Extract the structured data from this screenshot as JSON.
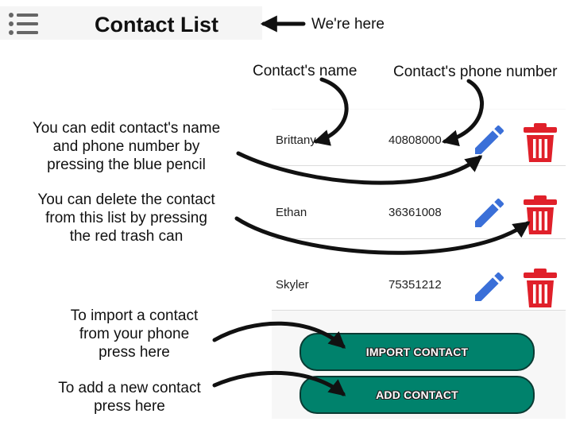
{
  "header": {
    "title": "Contact List",
    "menu_icon": "hamburger-menu-icon"
  },
  "contacts": [
    {
      "name": "Brittany",
      "phone": "40808000"
    },
    {
      "name": "Ethan",
      "phone": "36361008"
    },
    {
      "name": "Skyler",
      "phone": "75351212"
    }
  ],
  "row_icons": {
    "edit": "pencil-icon",
    "delete": "trash-can-icon"
  },
  "buttons": {
    "import_label": "IMPORT CONTACT",
    "add_label": "ADD CONTACT"
  },
  "annotations": {
    "here": "We're here",
    "contact_name": "Contact's name",
    "contact_phone": "Contact's phone number",
    "edit_note": [
      "You can edit contact's name",
      "and phone number by",
      "pressing the blue pencil"
    ],
    "delete_note": [
      "You can delete the contact",
      "from this list by pressing",
      "the red trash can"
    ],
    "import_note": [
      "To import a contact",
      "from your phone",
      "press here"
    ],
    "add_note": [
      "To add a new contact",
      "press here"
    ]
  },
  "colors": {
    "pencil_blue": "#3a6fd8",
    "trash_red": "#e0202a",
    "button_green": "#00826c"
  }
}
